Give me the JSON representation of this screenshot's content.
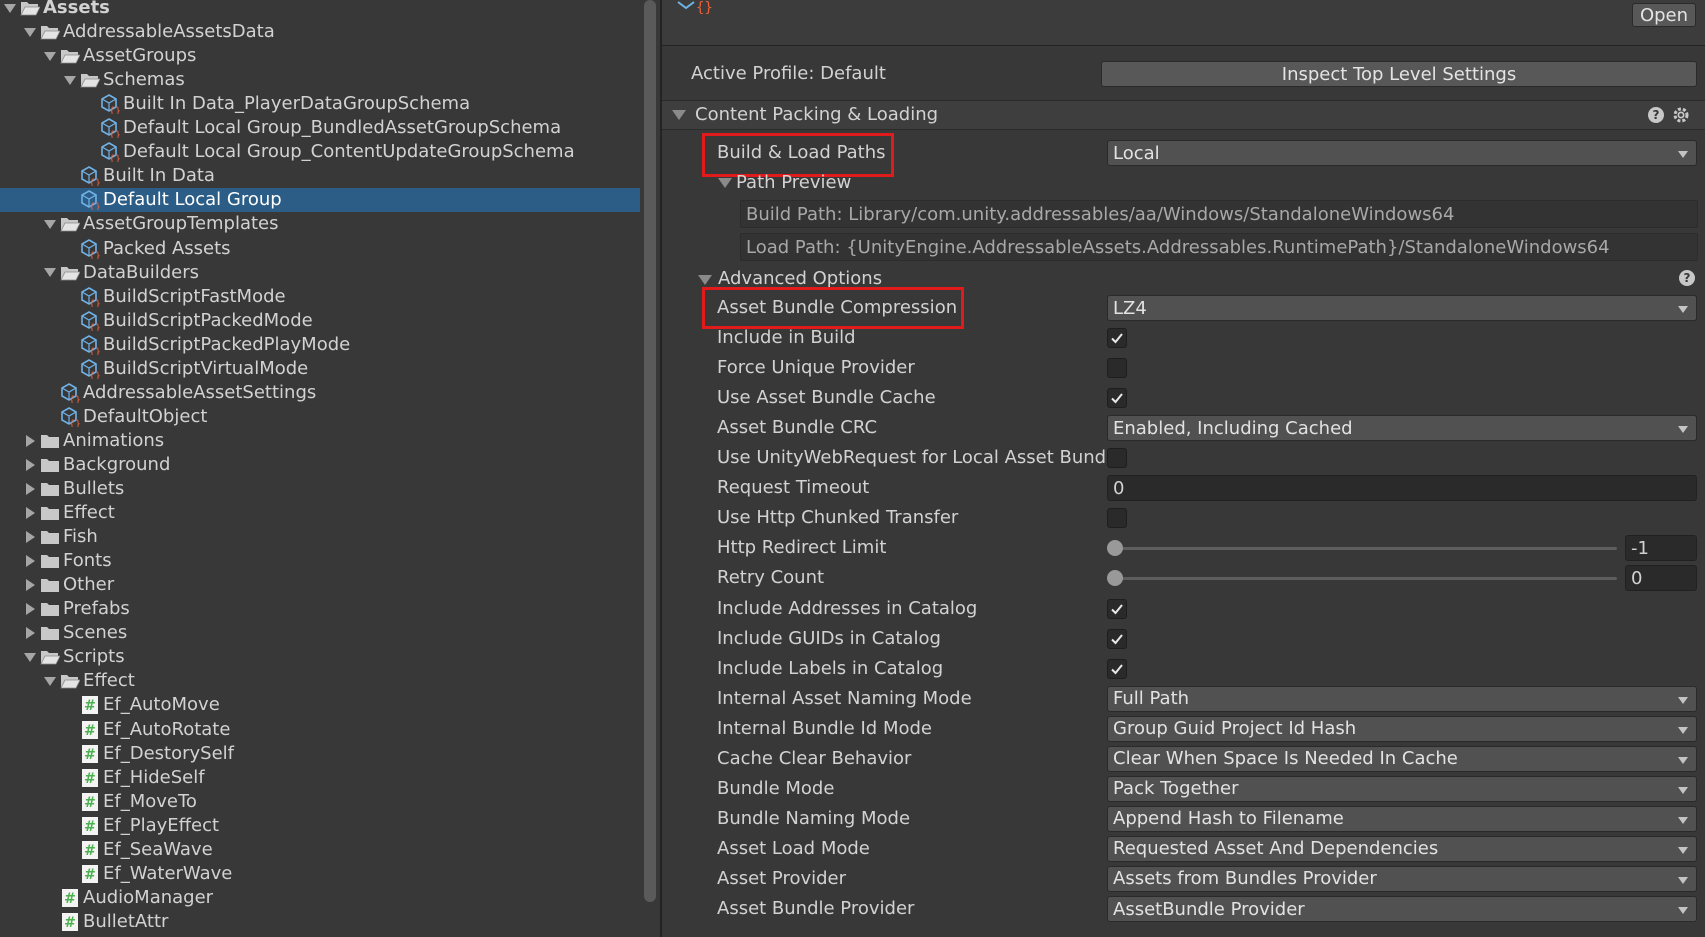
{
  "tree": {
    "items": [
      {
        "label": "Assets",
        "depth": 0,
        "arrow": "down",
        "icon": "folder-open",
        "root": true
      },
      {
        "label": "AddressableAssetsData",
        "depth": 1,
        "arrow": "down",
        "icon": "folder-open"
      },
      {
        "label": "AssetGroups",
        "depth": 2,
        "arrow": "down",
        "icon": "folder-open"
      },
      {
        "label": "Schemas",
        "depth": 3,
        "arrow": "down",
        "icon": "folder-open"
      },
      {
        "label": "Built In Data_PlayerDataGroupSchema",
        "depth": 4,
        "arrow": "none",
        "icon": "scriptable-object"
      },
      {
        "label": "Default Local Group_BundledAssetGroupSchema",
        "depth": 4,
        "arrow": "none",
        "icon": "scriptable-object"
      },
      {
        "label": "Default Local Group_ContentUpdateGroupSchema",
        "depth": 4,
        "arrow": "none",
        "icon": "scriptable-object"
      },
      {
        "label": "Built In Data",
        "depth": 3,
        "arrow": "none",
        "icon": "scriptable-object"
      },
      {
        "label": "Default Local Group",
        "depth": 3,
        "arrow": "none",
        "icon": "scriptable-object",
        "selected": true
      },
      {
        "label": "AssetGroupTemplates",
        "depth": 2,
        "arrow": "down",
        "icon": "folder-open"
      },
      {
        "label": "Packed Assets",
        "depth": 3,
        "arrow": "none",
        "icon": "scriptable-object"
      },
      {
        "label": "DataBuilders",
        "depth": 2,
        "arrow": "down",
        "icon": "folder-open"
      },
      {
        "label": "BuildScriptFastMode",
        "depth": 3,
        "arrow": "none",
        "icon": "scriptable-object"
      },
      {
        "label": "BuildScriptPackedMode",
        "depth": 3,
        "arrow": "none",
        "icon": "scriptable-object"
      },
      {
        "label": "BuildScriptPackedPlayMode",
        "depth": 3,
        "arrow": "none",
        "icon": "scriptable-object"
      },
      {
        "label": "BuildScriptVirtualMode",
        "depth": 3,
        "arrow": "none",
        "icon": "scriptable-object"
      },
      {
        "label": "AddressableAssetSettings",
        "depth": 2,
        "arrow": "none",
        "icon": "scriptable-object"
      },
      {
        "label": "DefaultObject",
        "depth": 2,
        "arrow": "none",
        "icon": "scriptable-object"
      },
      {
        "label": "Animations",
        "depth": 1,
        "arrow": "right",
        "icon": "folder"
      },
      {
        "label": "Background",
        "depth": 1,
        "arrow": "right",
        "icon": "folder"
      },
      {
        "label": "Bullets",
        "depth": 1,
        "arrow": "right",
        "icon": "folder"
      },
      {
        "label": "Effect",
        "depth": 1,
        "arrow": "right",
        "icon": "folder"
      },
      {
        "label": "Fish",
        "depth": 1,
        "arrow": "right",
        "icon": "folder"
      },
      {
        "label": "Fonts",
        "depth": 1,
        "arrow": "right",
        "icon": "folder"
      },
      {
        "label": "Other",
        "depth": 1,
        "arrow": "right",
        "icon": "folder"
      },
      {
        "label": "Prefabs",
        "depth": 1,
        "arrow": "right",
        "icon": "folder"
      },
      {
        "label": "Scenes",
        "depth": 1,
        "arrow": "right",
        "icon": "folder"
      },
      {
        "label": "Scripts",
        "depth": 1,
        "arrow": "down",
        "icon": "folder-open"
      },
      {
        "label": "Effect",
        "depth": 2,
        "arrow": "down",
        "icon": "folder-open"
      },
      {
        "label": "Ef_AutoMove",
        "depth": 3,
        "arrow": "none",
        "icon": "csharp-script"
      },
      {
        "label": "Ef_AutoRotate",
        "depth": 3,
        "arrow": "none",
        "icon": "csharp-script"
      },
      {
        "label": "Ef_DestorySelf",
        "depth": 3,
        "arrow": "none",
        "icon": "csharp-script"
      },
      {
        "label": "Ef_HideSelf",
        "depth": 3,
        "arrow": "none",
        "icon": "csharp-script"
      },
      {
        "label": "Ef_MoveTo",
        "depth": 3,
        "arrow": "none",
        "icon": "csharp-script"
      },
      {
        "label": "Ef_PlayEffect",
        "depth": 3,
        "arrow": "none",
        "icon": "csharp-script"
      },
      {
        "label": "Ef_SeaWave",
        "depth": 3,
        "arrow": "none",
        "icon": "csharp-script"
      },
      {
        "label": "Ef_WaterWave",
        "depth": 3,
        "arrow": "none",
        "icon": "csharp-script"
      },
      {
        "label": "AudioManager",
        "depth": 2,
        "arrow": "none",
        "icon": "csharp-script"
      },
      {
        "label": "BulletAttr",
        "depth": 2,
        "arrow": "none",
        "icon": "csharp-script"
      }
    ]
  },
  "inspector": {
    "open_button": "Open",
    "active_profile": "Active Profile: Default",
    "inspect_button": "Inspect Top Level Settings",
    "section_title": "Content Packing & Loading",
    "build_load_paths": {
      "label": "Build & Load Paths",
      "value": "Local"
    },
    "path_preview": {
      "title": "Path Preview",
      "build_path": "Build Path: Library/com.unity.addressables/aa/Windows/StandaloneWindows64",
      "load_path": "Load Path: {UnityEngine.AddressableAssets.Addressables.RuntimePath}/StandaloneWindows64"
    },
    "advanced_title": "Advanced Options",
    "fields": [
      {
        "label": "Asset Bundle Compression",
        "type": "dropdown",
        "value": "LZ4"
      },
      {
        "label": "Include in Build",
        "type": "checkbox",
        "checked": true
      },
      {
        "label": "Force Unique Provider",
        "type": "checkbox",
        "checked": false
      },
      {
        "label": "Use Asset Bundle Cache",
        "type": "checkbox",
        "checked": true
      },
      {
        "label": "Asset Bundle CRC",
        "type": "dropdown",
        "value": "Enabled, Including Cached"
      },
      {
        "label": "Use UnityWebRequest for Local Asset Bundles",
        "type": "checkbox",
        "checked": false
      },
      {
        "label": "Request Timeout",
        "type": "text",
        "value": "0"
      },
      {
        "label": "Use Http Chunked Transfer",
        "type": "checkbox",
        "checked": false
      },
      {
        "label": "Http Redirect Limit",
        "type": "slider",
        "value": "-1"
      },
      {
        "label": "Retry Count",
        "type": "slider",
        "value": "0"
      },
      {
        "label": "Include Addresses in Catalog",
        "type": "checkbox",
        "checked": true
      },
      {
        "label": "Include GUIDs in Catalog",
        "type": "checkbox",
        "checked": true
      },
      {
        "label": "Include Labels in Catalog",
        "type": "checkbox",
        "checked": true
      },
      {
        "label": "Internal Asset Naming Mode",
        "type": "dropdown",
        "value": "Full Path"
      },
      {
        "label": "Internal Bundle Id Mode",
        "type": "dropdown",
        "value": "Group Guid Project Id Hash"
      },
      {
        "label": "Cache Clear Behavior",
        "type": "dropdown",
        "value": "Clear When Space Is Needed In Cache"
      },
      {
        "label": "Bundle Mode",
        "type": "dropdown",
        "value": "Pack Together"
      },
      {
        "label": "Bundle Naming Mode",
        "type": "dropdown",
        "value": "Append Hash to Filename"
      },
      {
        "label": "Asset Load Mode",
        "type": "dropdown",
        "value": "Requested Asset And Dependencies"
      },
      {
        "label": "Asset Provider",
        "type": "dropdown",
        "value": "Assets from Bundles Provider"
      },
      {
        "label": "Asset Bundle Provider",
        "type": "dropdown",
        "value": "AssetBundle Provider"
      }
    ]
  },
  "colors": {
    "background": "#383838",
    "selection": "#2c5d87",
    "highlight_box": "#e01b1b",
    "script_icon": "#4caf50",
    "so_icon_blue": "#6fb2e8",
    "so_icon_orange": "#e8623a"
  }
}
